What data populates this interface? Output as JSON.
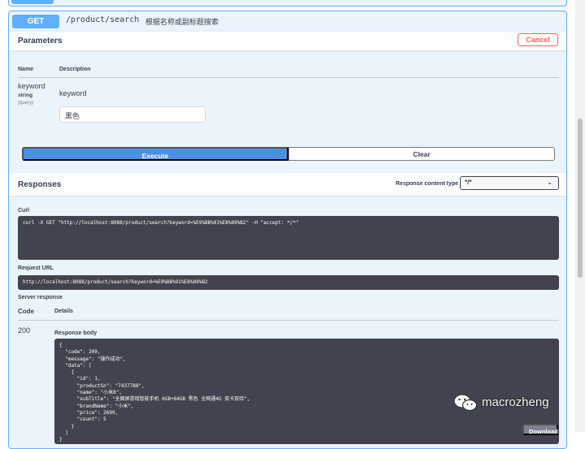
{
  "operation": {
    "method": "GET",
    "path": "/product/search",
    "description": "根据名称或副标题搜索"
  },
  "parameters": {
    "title": "Parameters",
    "cancel_label": "Cancel",
    "col_name": "Name",
    "col_description": "Description",
    "items": [
      {
        "name": "keyword",
        "type": "string",
        "in": "(query)",
        "description": "keyword",
        "value": "黑色"
      }
    ]
  },
  "actions": {
    "execute_label": "Execute",
    "clear_label": "Clear"
  },
  "responses": {
    "title": "Responses",
    "content_type_label": "Response content type",
    "content_type_value": "*/*",
    "curl_label": "Curl",
    "curl_command": "curl -X GET \"http://localhost:8088/product/search?keyword=%E9%BB%91%E8%89%B2\" -H \"accept: */*\"",
    "request_url_label": "Request URL",
    "request_url": "http://localhost:8088/product/search?keyword=%E9%BB%91%E8%89%B2",
    "server_response_label": "Server response",
    "code_col": "Code",
    "details_col": "Details",
    "code": "200",
    "body_label": "Response body",
    "body": "{\n  \"code\": 200,\n  \"message\": \"操作成功\",\n  \"data\": [\n    {\n      \"id\": 1,\n      \"productSn\": \"7437788\",\n      \"name\": \"小米8\",\n      \"subTitle\": \"全面屏游戏智能手机 6GB+64GB 黑色 全网通4G 双卡双待\",\n      \"brandName\": \"小米\",\n      \"price\": 2699,\n      \"count\": 5\n    }\n  ]\n}",
    "download_label": "Download"
  },
  "watermark": {
    "text": "macrozheng",
    "icon": "wechat-icon"
  },
  "colors": {
    "get_accent": "#61affe",
    "get_background": "#ebf3fb",
    "execute": "#4990e2",
    "cancel": "#ff6060",
    "code_background": "#41444e"
  }
}
